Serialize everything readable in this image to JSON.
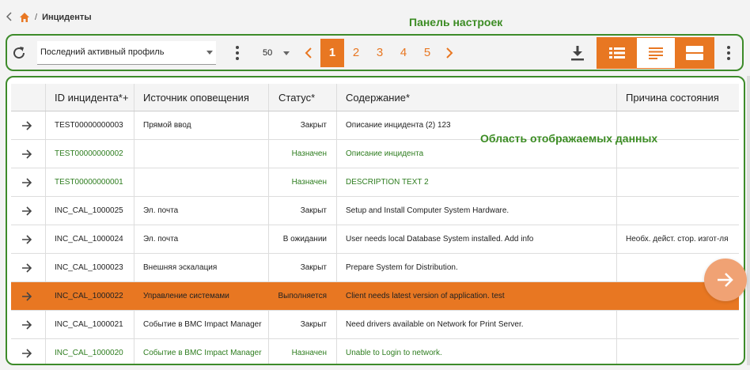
{
  "breadcrumb": {
    "back_icon": "chevron-left-icon",
    "home_icon": "home-icon",
    "separator": "/",
    "current": "Инциденты"
  },
  "annotations": {
    "toolbar_label": "Панель настроек",
    "data_area_label": "Область отображаемых данных"
  },
  "toolbar": {
    "refresh_icon": "refresh-icon",
    "profile": "Последний активный профиль",
    "page_size": "50",
    "pages": [
      "1",
      "2",
      "3",
      "4",
      "5"
    ],
    "active_page": "1",
    "download_icon": "download-icon",
    "views": [
      "list-view-icon",
      "text-view-icon",
      "split-view-icon"
    ]
  },
  "colors": {
    "accent": "#e87722",
    "annotation_green": "#3c8c24",
    "row_green": "#2e7d1f"
  },
  "table": {
    "columns": [
      "",
      "ID инцидента*+",
      "Источник оповещения",
      "Статус*",
      "Содержание*",
      "Причина состояния"
    ],
    "rows": [
      {
        "id": "TEST00000000003",
        "source": "Прямой ввод",
        "status": "Закрыт",
        "summary": "Описание инцидента (2) 123",
        "reason": "",
        "style": "normal"
      },
      {
        "id": "TEST00000000002",
        "source": "",
        "status": "Назначен",
        "summary": "Описание инцидента",
        "reason": "",
        "style": "green"
      },
      {
        "id": "TEST00000000001",
        "source": "",
        "status": "Назначен",
        "summary": "DESCRIPTION TEXT 2",
        "reason": "",
        "style": "green"
      },
      {
        "id": "INC_CAL_1000025",
        "source": "Эл. почта",
        "status": "Закрыт",
        "summary": "Setup and Install Computer System Hardware.",
        "reason": "",
        "style": "normal"
      },
      {
        "id": "INC_CAL_1000024",
        "source": "Эл. почта",
        "status": "В ожидании",
        "summary": "User needs local Database System installed. Add info",
        "reason": "Необх. дейст. стор. изгот-ля",
        "style": "normal"
      },
      {
        "id": "INC_CAL_1000023",
        "source": "Внешняя эскалация",
        "status": "Закрыт",
        "summary": "Prepare System for Distribution.",
        "reason": "",
        "style": "normal"
      },
      {
        "id": "INC_CAL_1000022",
        "source": "Управление системами",
        "status": "Выполняется",
        "summary": "Client needs latest version of application. test",
        "reason": "",
        "style": "selected"
      },
      {
        "id": "INC_CAL_1000021",
        "source": "Событие в BMC Impact Manager",
        "status": "Закрыт",
        "summary": "Need drivers available on Network for Print Server.",
        "reason": "",
        "style": "normal"
      },
      {
        "id": "INC_CAL_1000020",
        "source": "Событие в BMC Impact Manager",
        "status": "Назначен",
        "summary": "Unable to Login to network.",
        "reason": "",
        "style": "green"
      }
    ]
  }
}
